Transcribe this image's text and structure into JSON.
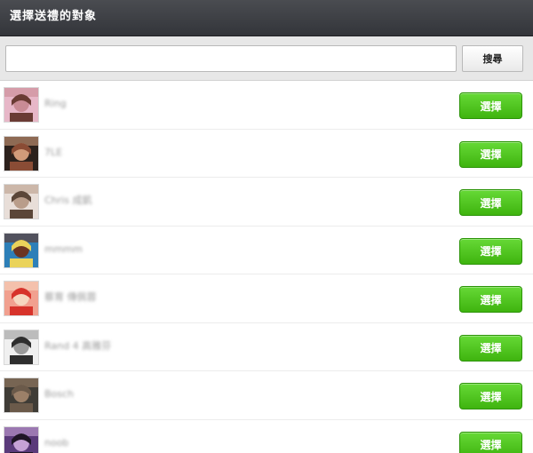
{
  "header": {
    "title": "選擇送禮的對象"
  },
  "search": {
    "value": "",
    "placeholder": "",
    "button_label": "搜尋"
  },
  "friends": [
    {
      "name": "Ring",
      "select_label": "選擇",
      "avatar": [
        "#e7b7c8",
        "#6a3b34",
        "#c98b95"
      ]
    },
    {
      "name": "7LE",
      "select_label": "選擇",
      "avatar": [
        "#2c211c",
        "#8a4c35",
        "#d19b7a"
      ]
    },
    {
      "name": "Chris 成凱",
      "select_label": "選擇",
      "avatar": [
        "#e8ded8",
        "#5b4638",
        "#b99d8a"
      ]
    },
    {
      "name": "mmmm",
      "select_label": "選擇",
      "avatar": [
        "#2d7fb8",
        "#ead35a",
        "#6b3421"
      ]
    },
    {
      "name": "蔡育 傳佩蓉",
      "select_label": "選擇",
      "avatar": [
        "#f1a08f",
        "#d7332b",
        "#f6d7c0"
      ]
    },
    {
      "name": "Rand 4 高雅芬",
      "select_label": "選擇",
      "avatar": [
        "#f0f0f0",
        "#2e2e2e",
        "#9a9a9a"
      ]
    },
    {
      "name": "Bosch",
      "select_label": "選擇",
      "avatar": [
        "#3f3c36",
        "#6b5a4a",
        "#9c8068"
      ]
    },
    {
      "name": "noob",
      "select_label": "選擇",
      "avatar": [
        "#5a3a7a",
        "#1f1626",
        "#c6a2d6"
      ]
    }
  ],
  "colors": {
    "header_bg": "#3d3f44",
    "select_button": "#4cc21a",
    "search_bar_bg": "#e7e7e7"
  }
}
